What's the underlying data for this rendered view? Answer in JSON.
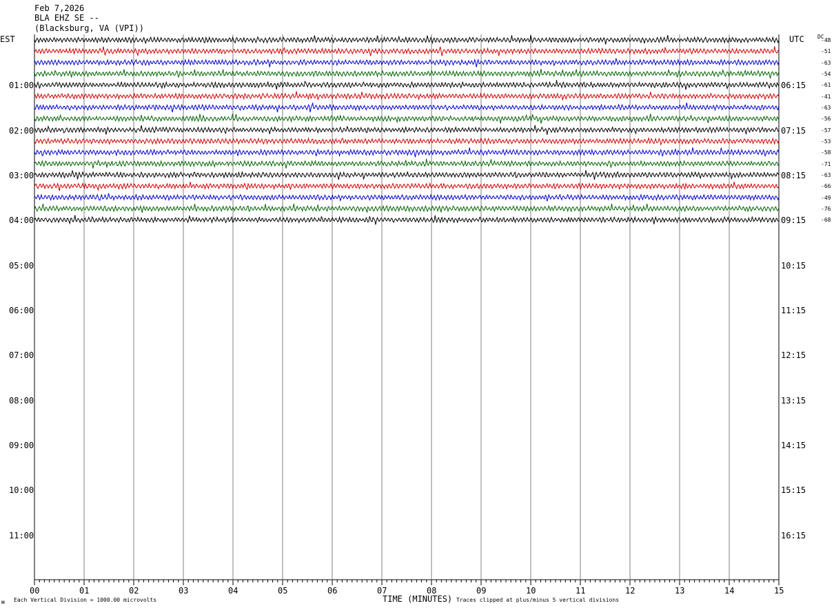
{
  "header": {
    "date": "Feb 7,2026",
    "station": "BLA EHZ SE --",
    "location": "(Blacksburg, VA (VPI))"
  },
  "left_axis_title": "EST",
  "right_axis_title": "UTC",
  "dc_title": "DC",
  "footer": {
    "scale_note": "Each Vertical Division = 1000.00 microvolts",
    "clip_note": "Traces clipped at plus/minus 5 vertical divisions",
    "corner_mark": "ᴍ"
  },
  "colors": {
    "trace_cycle": [
      "#000000",
      "#d00000",
      "#0000d0",
      "#006400"
    ],
    "grid": "#808080",
    "background": "#ffffff"
  },
  "chart_data": {
    "type": "line",
    "subtype": "helicorder",
    "xlabel": "TIME (MINUTES)",
    "x_ticks": [
      "00",
      "01",
      "02",
      "03",
      "04",
      "05",
      "06",
      "07",
      "08",
      "09",
      "10",
      "11",
      "12",
      "13",
      "14",
      "15"
    ],
    "xlim": [
      0,
      15
    ],
    "minute_subdivisions": 10,
    "est_hour_labels": [
      "01:00",
      "02:00",
      "03:00",
      "04:00",
      "05:00",
      "06:00",
      "07:00",
      "08:00",
      "09:00",
      "10:00",
      "11:00"
    ],
    "utc_hour_labels": [
      "06:15",
      "07:15",
      "08:15",
      "09:15",
      "10:15",
      "11:15",
      "12:15",
      "13:15",
      "14:15",
      "15:15",
      "16:15"
    ],
    "rows_per_hour": 4,
    "total_rows": 48,
    "traces_recorded": 17,
    "dc_offsets": [
      -48,
      -51,
      -63,
      -54,
      -61,
      -41,
      -63,
      -56,
      -57,
      -53,
      -58,
      -71,
      -63,
      -66,
      -49,
      -76,
      -68
    ],
    "grid": true
  }
}
